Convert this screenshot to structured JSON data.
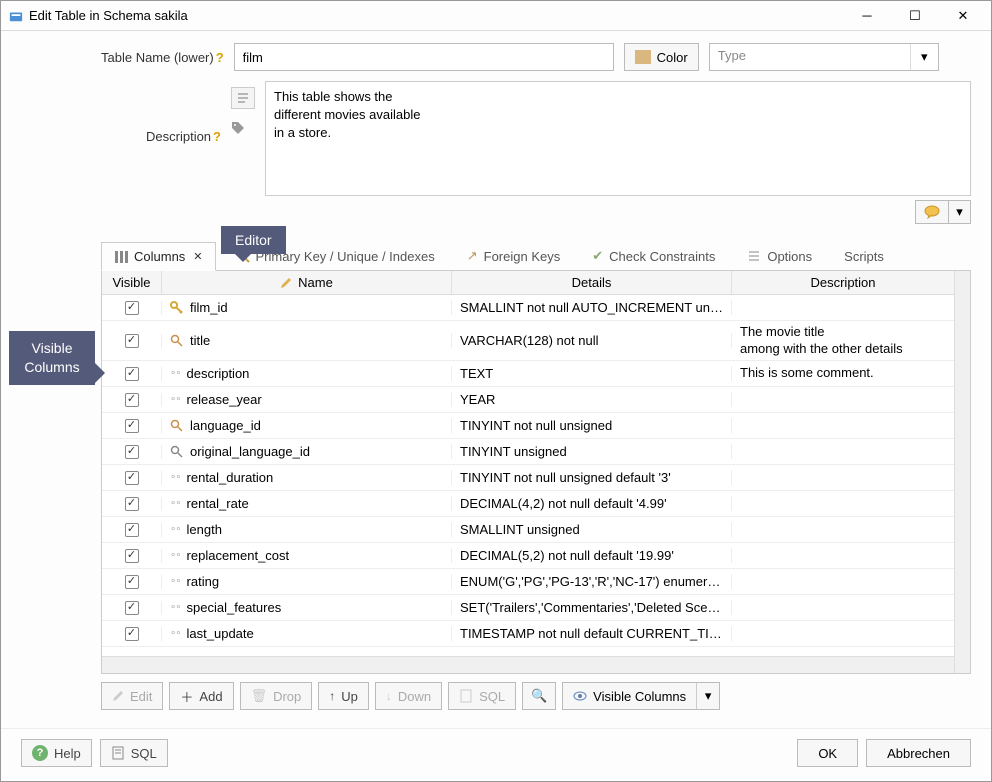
{
  "window": {
    "title": "Edit Table in Schema sakila"
  },
  "callouts": {
    "editor": "Editor",
    "visible_columns": "Visible\nColumns"
  },
  "form": {
    "table_name_label": "Table Name (lower)",
    "table_name_value": "film",
    "color_label": "Color",
    "type_placeholder": "Type",
    "description_label": "Description",
    "description_value": "This table shows the\ndifferent movies available\nin a store."
  },
  "tabs": {
    "columns": "Columns",
    "primary_key": "Primary Key / Unique / Indexes",
    "foreign_keys": "Foreign Keys",
    "check_constraints": "Check Constraints",
    "options": "Options",
    "scripts": "Scripts"
  },
  "grid": {
    "headers": {
      "visible": "Visible",
      "name": "Name",
      "details": "Details",
      "description": "Description"
    },
    "rows": [
      {
        "visible": true,
        "icon": "pk",
        "name": "film_id",
        "details": "SMALLINT not null AUTO_INCREMENT unsi...",
        "description": ""
      },
      {
        "visible": true,
        "icon": "idx",
        "name": "title",
        "details": "VARCHAR(128) not null",
        "description": "The movie title\namong with the other details",
        "tall": true
      },
      {
        "visible": true,
        "icon": "col",
        "name": "description",
        "details": "TEXT",
        "description": "This is some comment."
      },
      {
        "visible": true,
        "icon": "col",
        "name": "release_year",
        "details": "YEAR",
        "description": ""
      },
      {
        "visible": true,
        "icon": "idx",
        "name": "language_id",
        "details": "TINYINT not null unsigned",
        "description": ""
      },
      {
        "visible": true,
        "icon": "fk",
        "name": "original_language_id",
        "details": "TINYINT unsigned",
        "description": ""
      },
      {
        "visible": true,
        "icon": "col",
        "name": "rental_duration",
        "details": "TINYINT not null unsigned default '3'",
        "description": ""
      },
      {
        "visible": true,
        "icon": "col",
        "name": "rental_rate",
        "details": "DECIMAL(4,2) not null default '4.99'",
        "description": ""
      },
      {
        "visible": true,
        "icon": "col",
        "name": "length",
        "details": "SMALLINT unsigned",
        "description": ""
      },
      {
        "visible": true,
        "icon": "col",
        "name": "replacement_cost",
        "details": "DECIMAL(5,2) not null default '19.99'",
        "description": ""
      },
      {
        "visible": true,
        "icon": "col",
        "name": "rating",
        "details": "ENUM('G','PG','PG-13','R','NC-17') enumera...",
        "description": ""
      },
      {
        "visible": true,
        "icon": "col",
        "name": "special_features",
        "details": "SET('Trailers','Commentaries','Deleted Scen...",
        "description": ""
      },
      {
        "visible": true,
        "icon": "col",
        "name": "last_update",
        "details": "TIMESTAMP not null default CURRENT_TIM...",
        "description": ""
      }
    ]
  },
  "toolbar": {
    "edit": "Edit",
    "add": "Add",
    "drop": "Drop",
    "up": "Up",
    "down": "Down",
    "sql": "SQL",
    "visible_columns": "Visible Columns"
  },
  "footer": {
    "help": "Help",
    "sql": "SQL",
    "ok": "OK",
    "cancel": "Abbrechen"
  }
}
